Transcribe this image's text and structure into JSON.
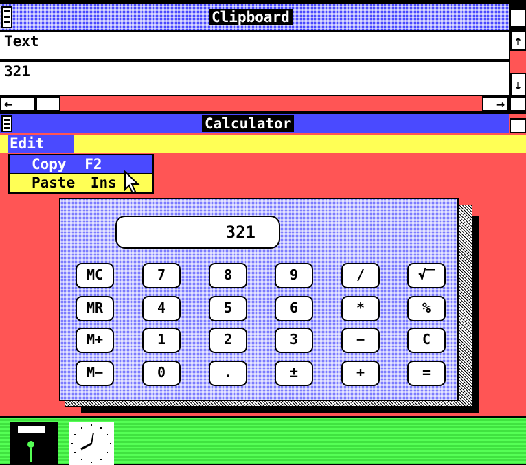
{
  "clipboard": {
    "title": "Clipboard",
    "format": "Text",
    "content": "321",
    "scroll_up": "↑",
    "scroll_down": "↓",
    "scroll_left": "←",
    "scroll_right": "→"
  },
  "calculator": {
    "title": "Calculator",
    "menu": {
      "edit_label": "Edit"
    },
    "edit_menu": {
      "items": [
        {
          "label": "Copy",
          "shortcut": "F2"
        },
        {
          "label": "Paste",
          "shortcut": "Ins"
        }
      ]
    },
    "display": "321",
    "keys": [
      [
        "MC",
        "7",
        "8",
        "9",
        "/",
        "√‾"
      ],
      [
        "MR",
        "4",
        "5",
        "6",
        "*",
        "%"
      ],
      [
        "M+",
        "1",
        "2",
        "3",
        "−",
        "C"
      ],
      [
        "M−",
        "0",
        ".",
        "±",
        "+",
        "="
      ]
    ]
  },
  "colors": {
    "desktop": "#000000",
    "titlebar": "#4a4aff",
    "client": "#ff5555",
    "menubar": "#ffff55",
    "iconbar": "#55ff55"
  },
  "icons": [
    "disk-icon",
    "clock-icon",
    "mouse-pointer-icon"
  ]
}
